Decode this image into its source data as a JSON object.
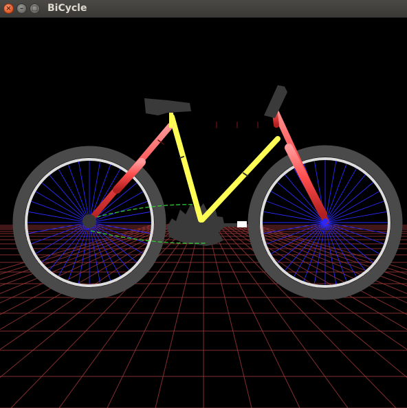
{
  "window": {
    "title": "BiCycle",
    "buttons": {
      "close_glyph": "×",
      "minimize_glyph": "–",
      "maximize_glyph": "□"
    }
  },
  "scene": {
    "background_color": "#000000",
    "ground_grid_color": "#a23a3a",
    "frame_main_color": "#ff4d4d",
    "frame_secondary_color": "#ffff55",
    "tire_color": "#4a4a4a",
    "rim_color": "#dcdcdc",
    "spoke_color": "#2a2aff",
    "chain_color": "#33cc33",
    "saddle_color": "#3a3a3a"
  }
}
